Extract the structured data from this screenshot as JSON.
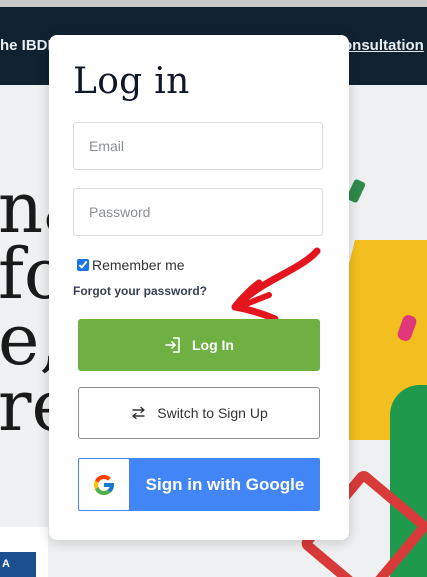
{
  "background": {
    "nav_left_text": "he IBDI",
    "nav_right_text": "onsultation",
    "hero_lines": [
      "na",
      "fo",
      "e,",
      "re"
    ],
    "bottom_tag": "A"
  },
  "modal": {
    "title": "Log in",
    "email_placeholder": "Email",
    "password_placeholder": "Password",
    "remember_label": "Remember me",
    "remember_checked": true,
    "forgot_label": "Forgot your password?",
    "login_label": "Log In",
    "switch_label": "Switch to Sign Up",
    "google_label": "Sign in with Google"
  },
  "colors": {
    "login_button": "#6fb043",
    "google_button": "#4285f4",
    "annotation_arrow": "#e3151d",
    "nav_background": "#102230"
  },
  "icons": {
    "login": "login-arrow-icon",
    "switch": "swap-arrows-icon",
    "google": "google-g-icon",
    "annotation": "red-arrow-annotation"
  }
}
